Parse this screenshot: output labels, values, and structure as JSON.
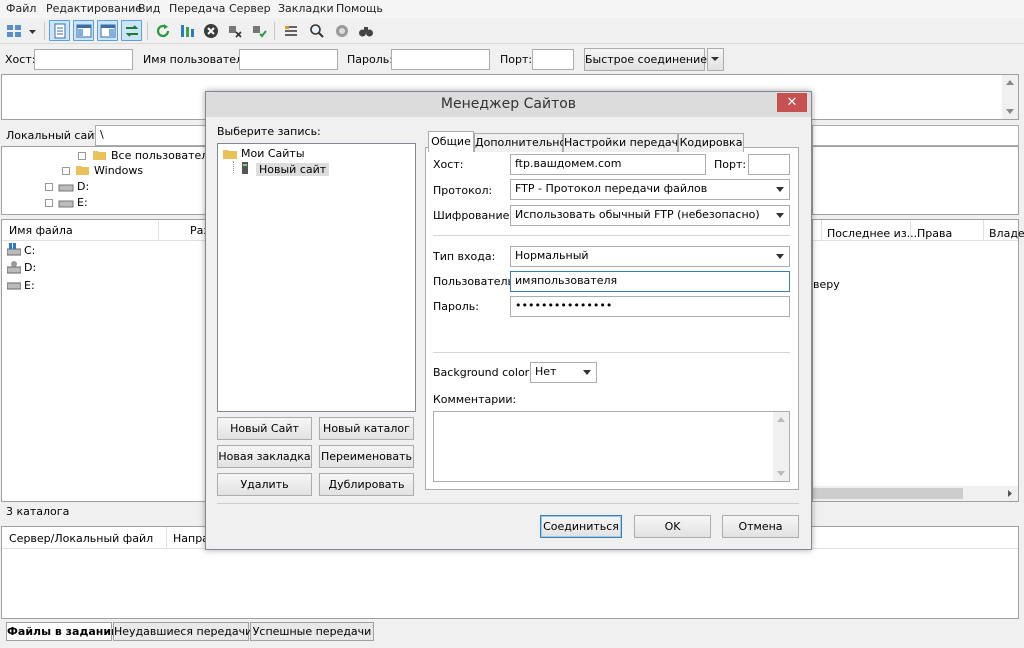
{
  "menu": [
    "Файл",
    "Редактирование",
    "Вид",
    "Передача",
    "Сервер",
    "Закладки",
    "Помощь"
  ],
  "toolbar": {
    "icons": [
      "site-manager-icon",
      "dropdown-arrow-icon",
      "toggle-message-log-icon",
      "toggle-local-tree-icon",
      "toggle-remote-tree-icon",
      "toggle-queue-icon",
      "refresh-icon",
      "process-queue-icon",
      "cancel-icon",
      "disconnect-icon",
      "reconnect-icon",
      "filter-icon",
      "toggle-compare-icon",
      "sync-browse-icon",
      "search-icon"
    ]
  },
  "quickconnect": {
    "host_label": "Хост:",
    "user_label": "Имя пользователя",
    "pass_label": "Пароль:",
    "port_label": "Порт:",
    "connect_button": "Быстрое соединение"
  },
  "local": {
    "site_label": "Локальный сайт:",
    "path": "\\",
    "tree": [
      "Все пользователи",
      "Windows",
      "D:",
      "E:"
    ],
    "columns": [
      "Имя файла",
      "Раз"
    ],
    "files": [
      "C:",
      "D:",
      "E:"
    ],
    "status": "3 каталога"
  },
  "remote": {
    "columns": [
      "Последнее из...",
      "Права",
      "Владе"
    ],
    "message_fragment": "веру"
  },
  "queue": {
    "columns": [
      "Сервер/Локальный файл",
      "Напра"
    ],
    "tabs": [
      "Файлы в задании",
      "Неудавшиеся передачи",
      "Успешные передачи"
    ]
  },
  "dialog": {
    "title": "Менеджер Сайтов",
    "select_entry_label": "Выберите запись:",
    "tree_root": "Мои Сайты",
    "tree_child": "Новый сайт",
    "buttons": {
      "new_site": "Новый Сайт",
      "new_folder": "Новый каталог",
      "new_bookmark": "Новая закладка",
      "rename": "Переименовать",
      "delete": "Удалить",
      "duplicate": "Дублировать",
      "connect": "Соединиться",
      "ok": "OK",
      "cancel": "Отмена"
    },
    "tabs": [
      "Общие",
      "Дополнительно",
      "Настройки передачи",
      "Кодировка"
    ],
    "general": {
      "host_label": "Хост:",
      "host_value": "ftp.вашдомем.com",
      "port_label": "Порт:",
      "port_value": "",
      "protocol_label": "Протокол:",
      "protocol_value": "FTP - Протокол передачи файлов",
      "encryption_label": "Шифрование:",
      "encryption_value": "Использовать обычный FTP (небезопасно)",
      "logon_type_label": "Тип входа:",
      "logon_type_value": "Нормальный",
      "user_label": "Пользователь:",
      "user_value": "имяпользователя",
      "password_label": "Пароль:",
      "password_value": "•••••••••••••••",
      "bg_color_label": "Background color:",
      "bg_color_value": "Нет",
      "comments_label": "Комментарии:"
    }
  }
}
